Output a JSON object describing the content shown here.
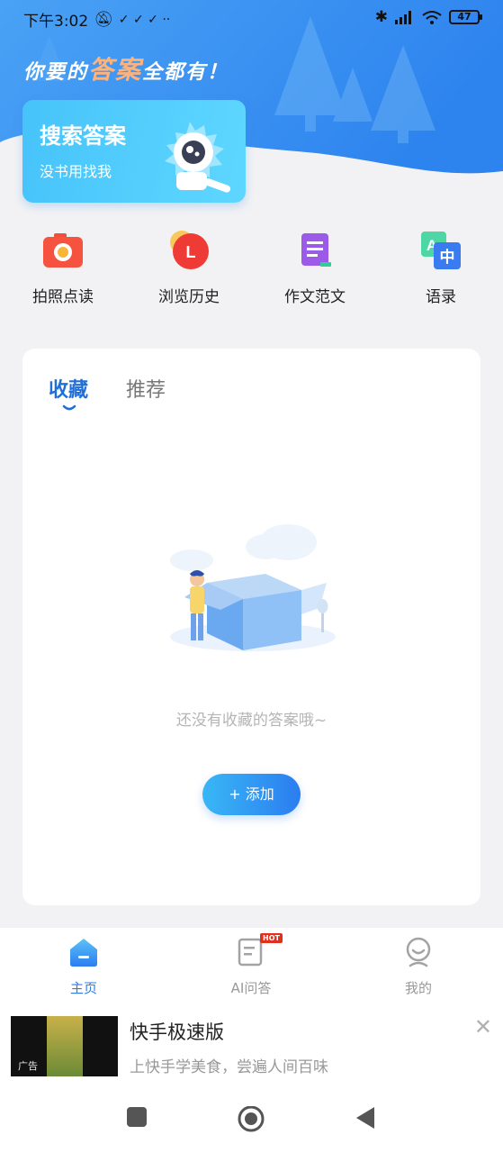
{
  "status_bar": {
    "time": "下午3:02",
    "extra_icons": "✓ ✓ ✓ ··",
    "battery": "47"
  },
  "header": {
    "slogan_pre": "你要的",
    "slogan_highlight": "答案",
    "slogan_post": "全都有！",
    "search_card": {
      "title": "搜索答案",
      "subtitle": "没书用找我"
    }
  },
  "tools": [
    {
      "label": "拍照点读",
      "icon": "camera-icon"
    },
    {
      "label": "浏览历史",
      "icon": "history-icon"
    },
    {
      "label": "作文范文",
      "icon": "essay-book-icon"
    },
    {
      "label": "语录",
      "icon": "quotes-translate-icon"
    }
  ],
  "favorites": {
    "tabs": [
      "收藏",
      "推荐"
    ],
    "active_tab": "收藏",
    "empty_text": "还没有收藏的答案哦~",
    "add_button": "+ 添加"
  },
  "bottom_nav": [
    {
      "label": "主页",
      "icon": "home-icon",
      "active": true
    },
    {
      "label": "AI问答",
      "icon": "ai-qa-icon",
      "badge": "HOT"
    },
    {
      "label": "我的",
      "icon": "profile-icon"
    }
  ],
  "ad": {
    "title": "快手极速版",
    "description": "上快手学美食，尝遍人间百味",
    "tag": "广告"
  },
  "colors": {
    "accent": "#2c7de8",
    "header_blue": "#3f8ef0",
    "hot_red": "#e0301e"
  }
}
